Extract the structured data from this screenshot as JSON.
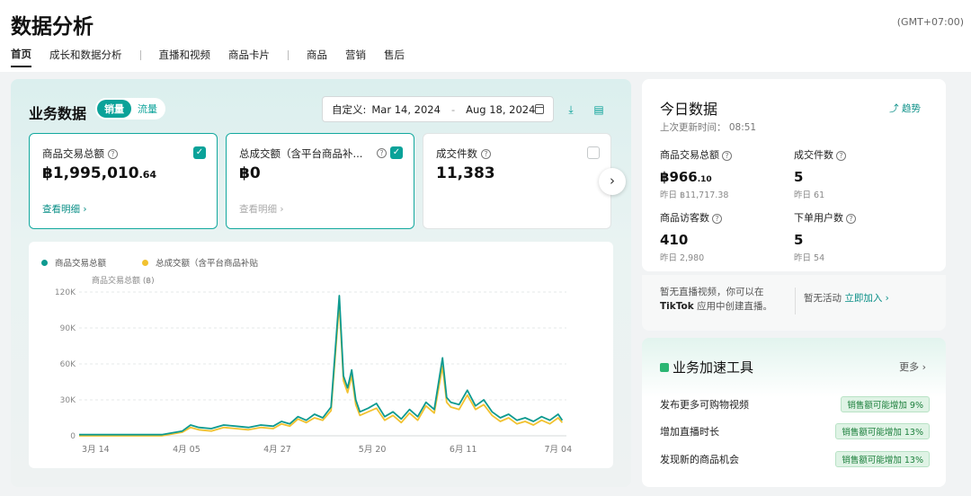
{
  "header": {
    "title": "数据分析",
    "timezone": "(GMT+07:00)",
    "tabs": [
      {
        "label": "首页",
        "active": true
      },
      {
        "label": "成长和数据分析",
        "active": false
      },
      {
        "label": "直播和视频",
        "active": false
      },
      {
        "label": "商品卡片",
        "active": false
      },
      {
        "label": "商品",
        "active": false
      },
      {
        "label": "营销",
        "active": false
      },
      {
        "label": "售后",
        "active": false
      }
    ]
  },
  "business": {
    "title": "业务数据",
    "toggle": [
      "销量",
      "流量"
    ],
    "date": {
      "label": "自定义:",
      "start": "Mar 14, 2024",
      "end": "Aug 18, 2024",
      "dash": "-"
    },
    "kpis": [
      {
        "label": "商品交易总额",
        "currency": "฿",
        "value": "1,995,010",
        "decimals": ".64",
        "link": "查看明细 ›",
        "selected": true
      },
      {
        "label": "总成交额（含平台商品补...",
        "currency": "฿",
        "value": "0",
        "decimals": "",
        "link": "查看明细 ›",
        "selected": true
      },
      {
        "label": "成交件数",
        "currency": "",
        "value": "11,383",
        "decimals": "",
        "link": "",
        "selected": false
      }
    ]
  },
  "chart_data": {
    "type": "line",
    "ylabel": "商品交易总额 (฿)",
    "yticks": [
      "0",
      "30K",
      "60K",
      "90K",
      "120K"
    ],
    "ylim": [
      0,
      120
    ],
    "xticks": [
      {
        "label": "3月 14",
        "day": 4
      },
      {
        "label": "4月 05",
        "day": 26
      },
      {
        "label": "4月 27",
        "day": 48
      },
      {
        "label": "5月 20",
        "day": 71
      },
      {
        "label": "6月 11",
        "day": 93
      },
      {
        "label": "7月 04",
        "day": 116
      }
    ],
    "xmax": 118,
    "grid": true,
    "series": [
      {
        "name": "商品交易总额",
        "color": "#0e9a90",
        "points": [
          [
            0,
            1
          ],
          [
            20,
            1
          ],
          [
            25,
            4
          ],
          [
            27,
            9
          ],
          [
            29,
            7
          ],
          [
            32,
            6
          ],
          [
            35,
            9
          ],
          [
            38,
            8
          ],
          [
            41,
            7
          ],
          [
            44,
            9
          ],
          [
            47,
            8
          ],
          [
            49,
            12
          ],
          [
            51,
            10
          ],
          [
            53,
            16
          ],
          [
            55,
            13
          ],
          [
            57,
            18
          ],
          [
            59,
            15
          ],
          [
            61,
            24
          ],
          [
            63,
            117
          ],
          [
            64,
            50
          ],
          [
            65,
            40
          ],
          [
            66,
            55
          ],
          [
            67,
            30
          ],
          [
            68,
            20
          ],
          [
            70,
            23
          ],
          [
            72,
            27
          ],
          [
            74,
            16
          ],
          [
            76,
            20
          ],
          [
            78,
            14
          ],
          [
            80,
            22
          ],
          [
            82,
            16
          ],
          [
            84,
            28
          ],
          [
            86,
            22
          ],
          [
            88,
            65
          ],
          [
            89,
            32
          ],
          [
            90,
            28
          ],
          [
            92,
            26
          ],
          [
            94,
            38
          ],
          [
            96,
            25
          ],
          [
            98,
            30
          ],
          [
            100,
            20
          ],
          [
            102,
            15
          ],
          [
            104,
            18
          ],
          [
            106,
            13
          ],
          [
            108,
            15
          ],
          [
            110,
            12
          ],
          [
            112,
            16
          ],
          [
            114,
            13
          ],
          [
            116,
            18
          ],
          [
            117,
            13
          ]
        ]
      },
      {
        "name": "总成交额（含平台商品补贴",
        "color": "#f2c230",
        "points": [
          [
            0,
            0
          ],
          [
            20,
            0
          ],
          [
            25,
            3
          ],
          [
            27,
            7
          ],
          [
            29,
            5
          ],
          [
            32,
            4
          ],
          [
            35,
            7
          ],
          [
            38,
            6
          ],
          [
            41,
            5
          ],
          [
            44,
            7
          ],
          [
            47,
            6
          ],
          [
            49,
            10
          ],
          [
            51,
            8
          ],
          [
            53,
            14
          ],
          [
            55,
            11
          ],
          [
            57,
            15
          ],
          [
            59,
            13
          ],
          [
            61,
            21
          ],
          [
            63,
            110
          ],
          [
            64,
            46
          ],
          [
            65,
            36
          ],
          [
            66,
            50
          ],
          [
            67,
            26
          ],
          [
            68,
            17
          ],
          [
            70,
            20
          ],
          [
            72,
            23
          ],
          [
            74,
            13
          ],
          [
            76,
            17
          ],
          [
            78,
            11
          ],
          [
            80,
            19
          ],
          [
            82,
            13
          ],
          [
            84,
            25
          ],
          [
            86,
            19
          ],
          [
            88,
            58
          ],
          [
            89,
            28
          ],
          [
            90,
            24
          ],
          [
            92,
            22
          ],
          [
            94,
            34
          ],
          [
            96,
            22
          ],
          [
            98,
            26
          ],
          [
            100,
            17
          ],
          [
            102,
            12
          ],
          [
            104,
            15
          ],
          [
            106,
            10
          ],
          [
            108,
            12
          ],
          [
            110,
            9
          ],
          [
            112,
            13
          ],
          [
            114,
            10
          ],
          [
            116,
            15
          ],
          [
            117,
            11
          ]
        ]
      }
    ]
  },
  "today": {
    "title": "今日数据",
    "updated": "上次更新时间： 08:51",
    "trend_label": "趋势",
    "metrics": [
      {
        "label": "商品交易总额",
        "currency": "฿",
        "value": "966",
        "decimals": ".10",
        "prev": "昨日 ฿11,717.38"
      },
      {
        "label": "成交件数",
        "currency": "",
        "value": "5",
        "decimals": "",
        "prev": "昨日 61"
      },
      {
        "label": "商品访客数",
        "currency": "",
        "value": "410",
        "decimals": "",
        "prev": "昨日 2,980"
      },
      {
        "label": "下单用户数",
        "currency": "",
        "value": "5",
        "decimals": "",
        "prev": "昨日 54"
      }
    ]
  },
  "live": {
    "text": "暂无直播视频，你可以在",
    "text_bold": "TikTok",
    "text_tail": "应用中创建直播。",
    "activity": "暂无活动",
    "join": "立即加入 ›"
  },
  "tools": {
    "title": "业务加速工具",
    "more": "更多 ›",
    "rows": [
      {
        "label": "发布更多可购物视频",
        "badge": "销售额可能增加 9%"
      },
      {
        "label": "增加直播时长",
        "badge": "销售额可能增加 13%"
      },
      {
        "label": "发现新的商品机会",
        "badge": "销售额可能增加 13%"
      }
    ]
  }
}
